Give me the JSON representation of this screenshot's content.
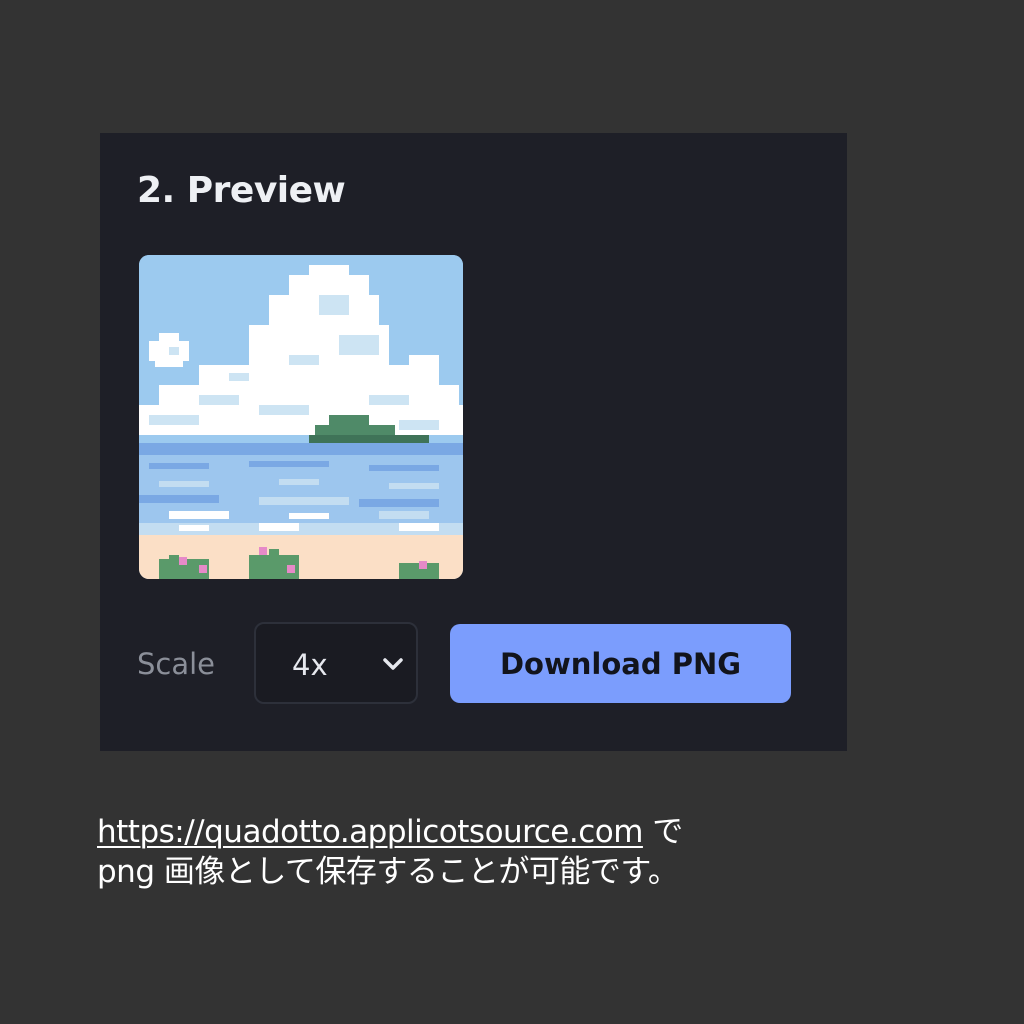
{
  "panel": {
    "title": "2. Preview"
  },
  "preview_image": {
    "name": "pixel-art-seaside-preview",
    "colors": {
      "sky": "#9ccaef",
      "cloud": "#ffffff",
      "cloud_shade": "#cde4f3",
      "sea_dark": "#7aa8e4",
      "sea_mid": "#9dc6ee",
      "sea_light": "#c3ddf1",
      "sand": "#fbdfc6",
      "island": "#4f8a68",
      "island_dark": "#3f7358",
      "plant": "#5a9a6a",
      "flower": "#e68ac8"
    }
  },
  "controls": {
    "scale_label": "Scale",
    "scale_selected": "4x",
    "download_label": "Download PNG",
    "accent_color": "#7b9dfd"
  },
  "caption": {
    "link_text": "https://quadotto.applicotsource.com",
    "after_link": " で",
    "line2": "png 画像として保存することが可能です。"
  }
}
